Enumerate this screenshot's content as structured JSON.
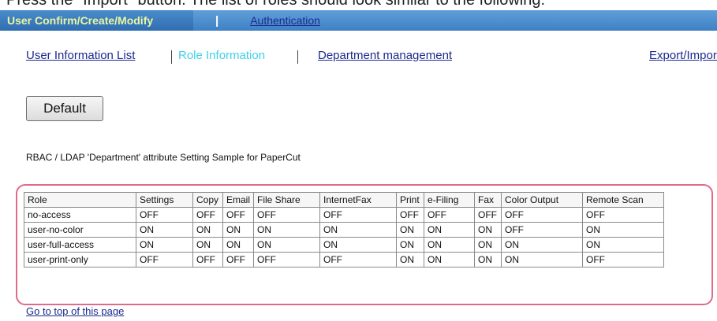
{
  "caption_partial": "Press the \"Import\" button. The list of roles should look similar to the following.",
  "header": {
    "title": "User Confirm/Create/Modify",
    "separator": "|",
    "auth_link": "Authentication"
  },
  "tabs": {
    "user_info": "User Information List",
    "role_info": "Role Information",
    "department": "Department management",
    "export": "Export/Import"
  },
  "default_button": "Default",
  "sample_heading": "RBAC / LDAP 'Department' attribute Setting Sample for PaperCut",
  "table": {
    "columns": [
      "Role",
      "Settings",
      "Copy",
      "Email",
      "File Share",
      "InternetFax",
      "Print",
      "e-Filing",
      "Fax",
      "Color Output",
      "Remote Scan"
    ],
    "rows": [
      [
        "no-access",
        "OFF",
        "OFF",
        "OFF",
        "OFF",
        "OFF",
        "OFF",
        "OFF",
        "OFF",
        "OFF",
        "OFF"
      ],
      [
        "user-no-color",
        "ON",
        "ON",
        "ON",
        "ON",
        "ON",
        "ON",
        "ON",
        "ON",
        "OFF",
        "ON"
      ],
      [
        "user-full-access",
        "ON",
        "ON",
        "ON",
        "ON",
        "ON",
        "ON",
        "ON",
        "ON",
        "ON",
        "ON"
      ],
      [
        "user-print-only",
        "OFF",
        "OFF",
        "OFF",
        "OFF",
        "OFF",
        "ON",
        "ON",
        "ON",
        "ON",
        "OFF"
      ]
    ]
  },
  "top_link": "Go to top of this page"
}
